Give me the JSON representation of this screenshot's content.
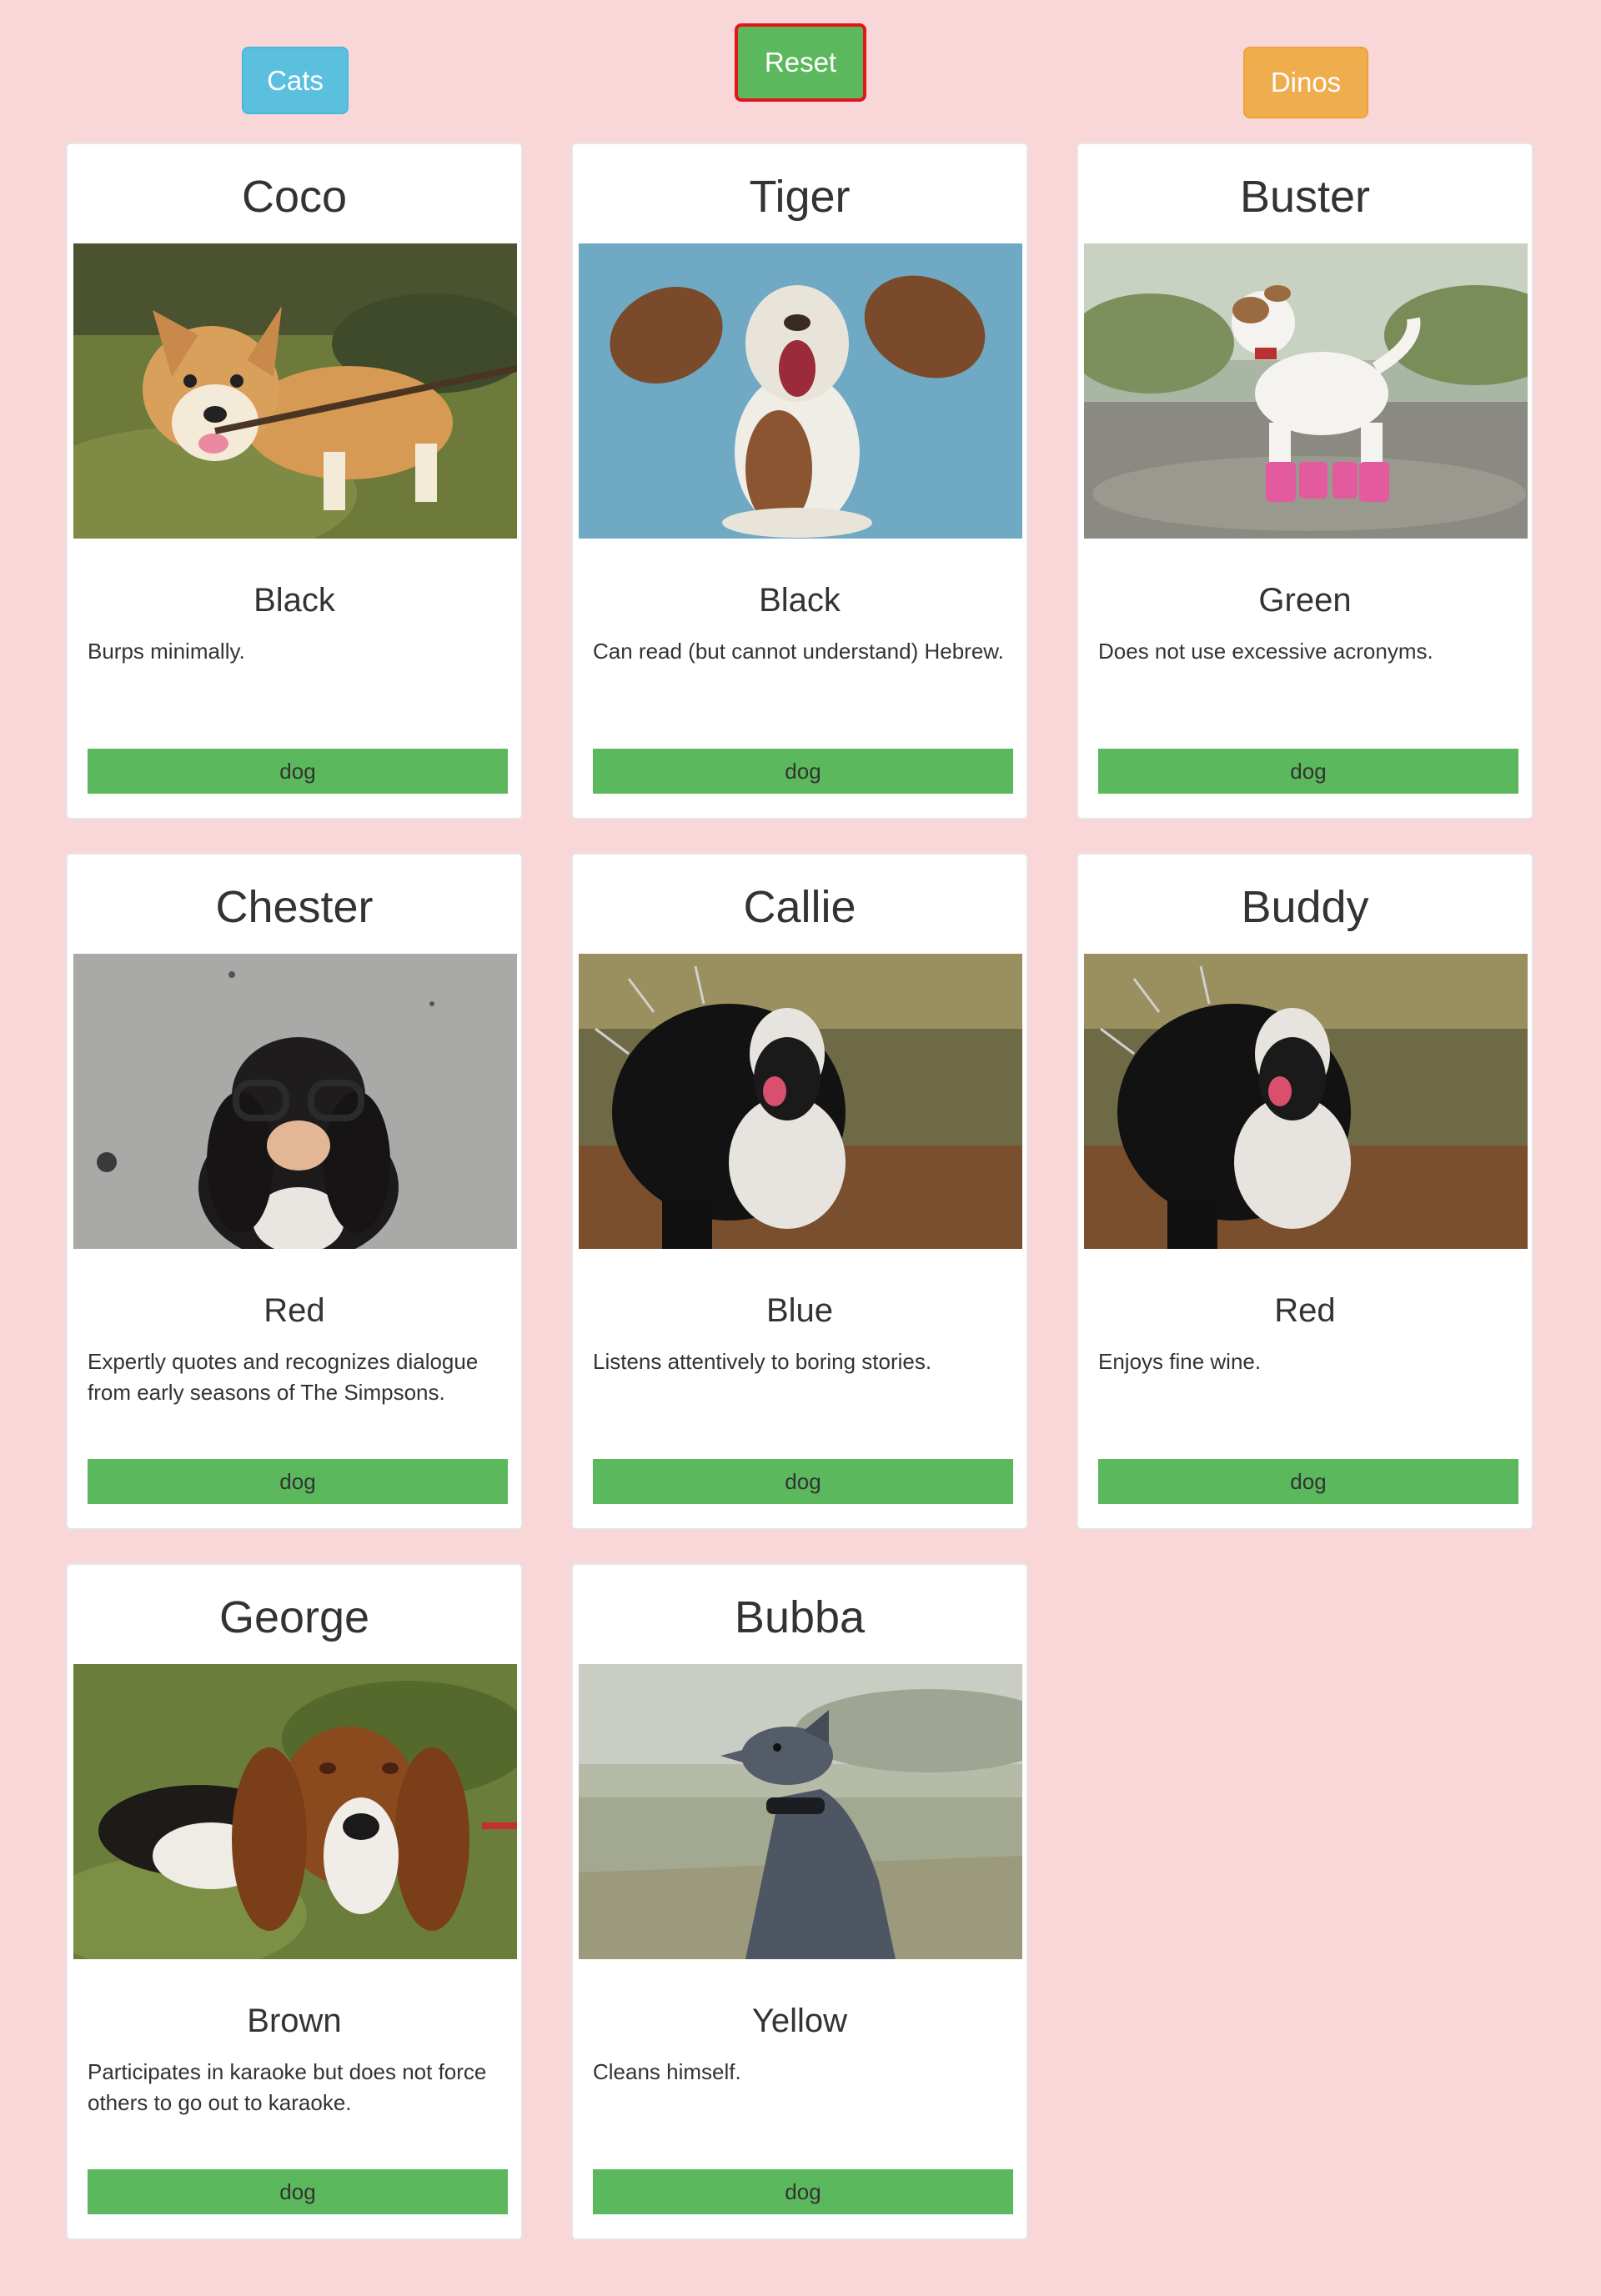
{
  "filters": {
    "cats_label": "Cats",
    "reset_label": "Reset",
    "dinos_label": "Dinos"
  },
  "cards": [
    {
      "name": "Coco",
      "color": "Black",
      "description": "Burps minimally.",
      "tag": "dog"
    },
    {
      "name": "Tiger",
      "color": "Black",
      "description": "Can read (but cannot understand) Hebrew.",
      "tag": "dog"
    },
    {
      "name": "Buster",
      "color": "Green",
      "description": "Does not use excessive acronyms.",
      "tag": "dog"
    },
    {
      "name": "Chester",
      "color": "Red",
      "description": "Expertly quotes and recognizes dialogue from early seasons of The Simpsons.",
      "tag": "dog"
    },
    {
      "name": "Callie",
      "color": "Blue",
      "description": "Listens attentively to boring stories.",
      "tag": "dog"
    },
    {
      "name": "Buddy",
      "color": "Red",
      "description": "Enjoys fine wine.",
      "tag": "dog"
    },
    {
      "name": "George",
      "color": "Brown",
      "description": "Participates in karaoke but does not force others to go out to karaoke.",
      "tag": "dog"
    },
    {
      "name": "Bubba",
      "color": "Yellow",
      "description": "Cleans himself.",
      "tag": "dog"
    }
  ],
  "colors": {
    "page_background": "#f9d6d7",
    "cats_button": "#5bc0de",
    "reset_button": "#5cb85c",
    "reset_border": "#e3141b",
    "dinos_button": "#f0ad4e",
    "tag_background": "#5cb85c"
  }
}
